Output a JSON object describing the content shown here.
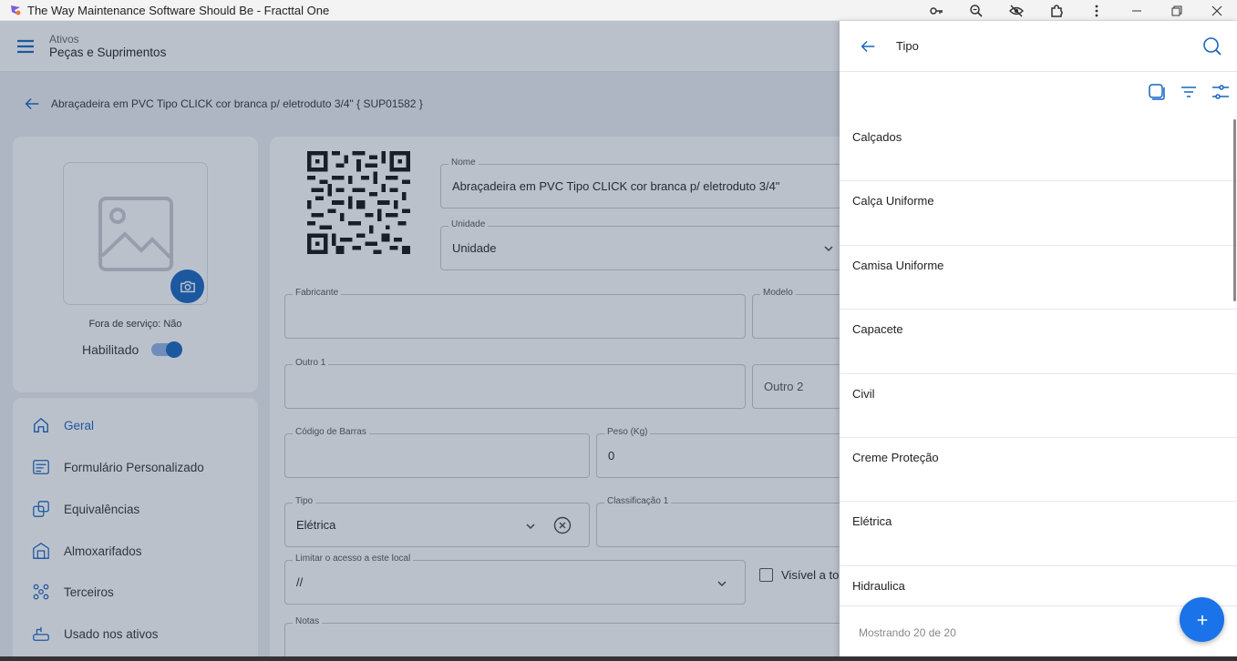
{
  "window": {
    "title": "The Way Maintenance Software Should Be - Fracttal One",
    "controls": [
      "key-icon",
      "zoom-icon",
      "eye-off-icon",
      "extension-icon",
      "more-icon",
      "minimize-icon",
      "restore-icon",
      "close-icon"
    ]
  },
  "header": {
    "supertitle": "Ativos",
    "title": "Peças e Suprimentos"
  },
  "breadcrumb": {
    "text": "Abraçadeira em PVC Tipo CLICK cor branca p/ eletroduto 3/4\" { SUP01582 }"
  },
  "photo_card": {
    "out_of_service": "Fora de serviço: Não",
    "enabled_label": "Habilitado",
    "enabled": true
  },
  "side_menu": {
    "items": [
      {
        "label": "Geral",
        "icon": "home-icon",
        "active": true
      },
      {
        "label": "Formulário Personalizado",
        "icon": "form-icon",
        "active": false
      },
      {
        "label": "Equivalências",
        "icon": "equivalence-icon",
        "active": false
      },
      {
        "label": "Almoxarifados",
        "icon": "warehouse-icon",
        "active": false
      },
      {
        "label": "Terceiros",
        "icon": "third-parties-icon",
        "active": false
      },
      {
        "label": "Usado nos ativos",
        "icon": "assets-icon",
        "active": false
      }
    ]
  },
  "form": {
    "nome": {
      "label": "Nome",
      "value": "Abraçadeira em PVC Tipo CLICK cor branca p/ eletroduto 3/4\""
    },
    "unidade": {
      "label": "Unidade",
      "value": "Unidade"
    },
    "fabricante": {
      "label": "Fabricante",
      "value": ""
    },
    "modelo": {
      "label": "Modelo",
      "value": ""
    },
    "outro1": {
      "label": "Outro 1",
      "value": ""
    },
    "outro2": {
      "placeholder": "Outro 2"
    },
    "codigo_barras": {
      "label": "Código de Barras",
      "value": ""
    },
    "peso": {
      "label": "Peso (Kg)",
      "value": "0"
    },
    "tipo": {
      "label": "Tipo",
      "value": "Elétrica"
    },
    "classificacao1": {
      "label": "Classificação 1",
      "value": ""
    },
    "limitar": {
      "label": "Limitar o acesso a este local",
      "value": "//"
    },
    "visivel": {
      "label": "Visível a to"
    },
    "notas": {
      "label": "Notas"
    }
  },
  "panel": {
    "title": "Tipo",
    "items": [
      "Calçados",
      "Calça Uniforme",
      "Camisa Uniforme",
      "Capacete",
      "Civil",
      "Creme Proteção",
      "Elétrica",
      "Hidraulica"
    ],
    "footer": "Mostrando 20 de 20"
  },
  "colors": {
    "accent": "#1565c0",
    "fab": "#1a73e8",
    "overlay": "#2d3e5c"
  }
}
